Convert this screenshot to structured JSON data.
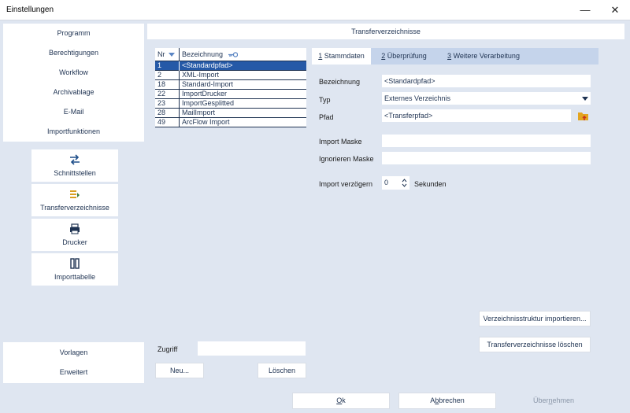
{
  "window": {
    "title": "Einstellungen",
    "minimize_glyph": "—",
    "close_glyph": "✕"
  },
  "nav_top": [
    "Programm",
    "Berechtigungen",
    "Workflow",
    "Archivablage",
    "E-Mail",
    "Importfunktionen"
  ],
  "tools": [
    {
      "label": "Schnittstellen",
      "icon": "swap-arrows-icon"
    },
    {
      "label": "Transferverzeichnisse",
      "icon": "folder-list-icon"
    },
    {
      "label": "Drucker",
      "icon": "printer-icon"
    },
    {
      "label": "Importtabelle",
      "icon": "table-icon"
    }
  ],
  "nav_bottom": [
    "Vorlagen",
    "Erweitert"
  ],
  "panel": {
    "title": "Transferverzeichnisse"
  },
  "list": {
    "columns": {
      "nr": "Nr",
      "bezeichnung": "Bezeichnung"
    },
    "rows": [
      {
        "nr": "1",
        "bez": "<Standardpfad>"
      },
      {
        "nr": "2",
        "bez": "XML-Import"
      },
      {
        "nr": "18",
        "bez": "Standard-Import"
      },
      {
        "nr": "22",
        "bez": "ImportDrucker"
      },
      {
        "nr": "23",
        "bez": "ImportGesplitted"
      },
      {
        "nr": "28",
        "bez": "MailImport"
      },
      {
        "nr": "49",
        "bez": "ArcFlow Import"
      }
    ],
    "selected_index": 0
  },
  "tabs": [
    {
      "num": "1",
      "label": " Stammdaten"
    },
    {
      "num": "2",
      "label": " Überprüfung"
    },
    {
      "num": "3",
      "label": " Weitere Verarbeitung"
    }
  ],
  "form": {
    "bezeichnung_label": "Bezeichnung",
    "bezeichnung_value": "<Standardpfad>",
    "typ_label": "Typ",
    "typ_value": "Externes Verzeichnis",
    "pfad_label": "Pfad",
    "pfad_value": "<Transferpfad>",
    "import_maske_label": "Import Maske",
    "import_maske_value": "",
    "ignorieren_maske_label": "Ignorieren Maske",
    "ignorieren_maske_value": "",
    "verzoegern_label": "Import verzögern",
    "verzoegern_value": "0",
    "sekunden_label": "Sekunden"
  },
  "zugriff": {
    "label": "Zugriff",
    "value": ""
  },
  "buttons": {
    "neu": "Neu...",
    "loeschen": "Löschen",
    "struktur_importieren": "Verzeichnisstruktur importieren...",
    "transfer_loeschen": "Transferverzeichnisse löschen",
    "ok_u": "O",
    "ok_rest": "k",
    "abbrechen_pre": "A",
    "abbrechen_u": "b",
    "abbrechen_rest": "brechen",
    "uebernehmen_pre": "Über",
    "uebernehmen_u": "n",
    "uebernehmen_rest": "ehmen"
  },
  "colors": {
    "selection": "#2559a7",
    "panel_bg": "#dfe6f1",
    "tab_bar": "#c5d4eb",
    "accent_text": "#1f3352"
  }
}
